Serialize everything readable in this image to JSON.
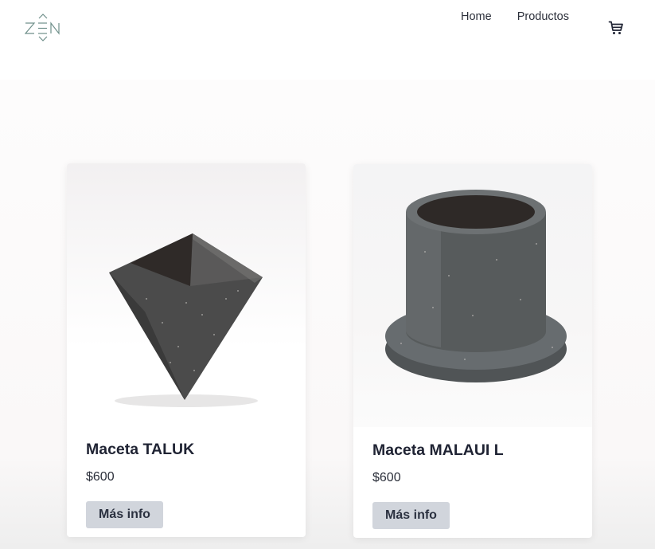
{
  "header": {
    "logo_text": "ZEN",
    "nav": [
      {
        "label": "Home"
      },
      {
        "label": "Productos"
      }
    ],
    "cart_icon": "cart-icon"
  },
  "products": [
    {
      "title": "Maceta TALUK",
      "price": "$600",
      "button_label": "Más info",
      "image": "octahedron-concrete-pot"
    },
    {
      "title": "Maceta MALAUI L",
      "price": "$600",
      "button_label": "Más info",
      "image": "cylinder-concrete-pot-with-saucer"
    }
  ]
}
